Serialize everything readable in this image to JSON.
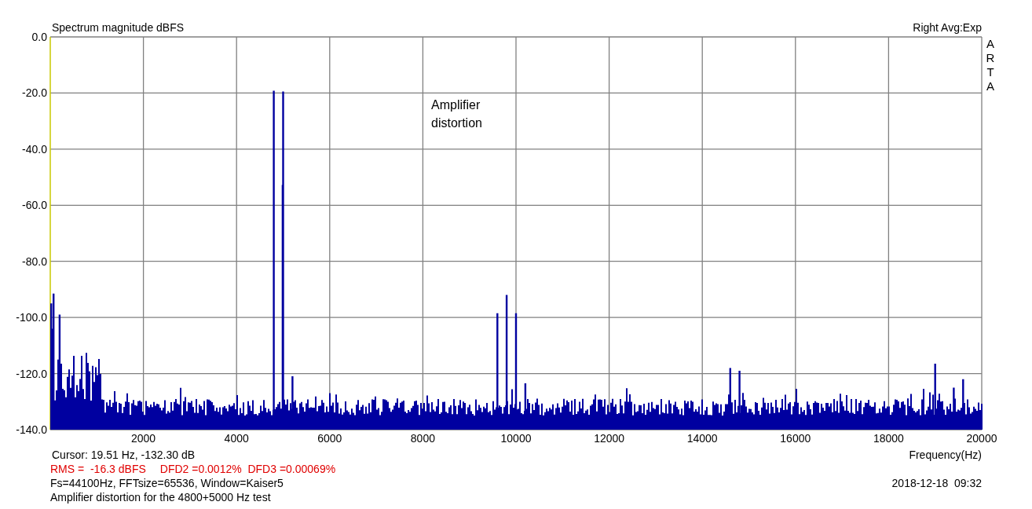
{
  "plot": {
    "title": "Spectrum magnitude dBFS",
    "channel_info": "Right Avg:Exp",
    "vertical_label": "ARTA",
    "y_ticks": [
      "0.0",
      "-20.0",
      "-40.0",
      "-60.0",
      "-80.0",
      "-100.0",
      "-120.0",
      "-140.0"
    ],
    "x_ticks": [
      "2000",
      "4000",
      "6000",
      "8000",
      "10000",
      "12000",
      "14000",
      "16000",
      "18000",
      "20000"
    ],
    "annotation": "Amplifier distortion",
    "x_axis_label": "Frequency(Hz)"
  },
  "footer": {
    "cursor": "Cursor: 19.51 Hz, -132.30 dB",
    "measurements": [
      "RMS =  -16.3 dBFS",
      "DFD2 =0.0012%  DFD3 =0.00069%"
    ],
    "settings": "Fs=44100Hz, FFTsize=65536, Window=Kaiser5",
    "description": "Amplifier distortion for the 4800+5000 Hz test",
    "timestamp": "2018-12-18  09:32"
  }
}
